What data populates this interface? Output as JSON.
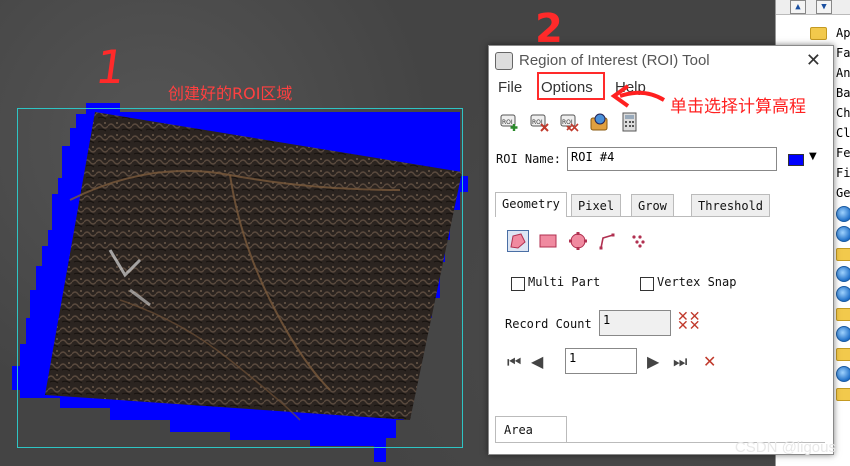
{
  "annotations": {
    "step1": "1",
    "step2": "2",
    "roi_created_text": "创建好的ROI区域",
    "step2_text": "单击选择计算高程"
  },
  "dialog": {
    "title": "Region of Interest (ROI) Tool",
    "close": "✕",
    "menu": [
      "File",
      "Options",
      "Help"
    ],
    "toolbar_icons": [
      "new-roi-icon",
      "delete-roi-icon",
      "delete-all-roi-icon",
      "open-roi-icon",
      "calculator-icon"
    ],
    "roi_name_label": "ROI Name:",
    "roi_name_value": "ROI #4",
    "roi_color": "#0000ff",
    "tabs": [
      "Geometry",
      "Pixel",
      "Grow",
      "Threshold"
    ],
    "geometry_tools": [
      "polygon-tool-icon",
      "rectangle-tool-icon",
      "ellipse-tool-icon",
      "polyline-tool-icon",
      "point-tool-icon"
    ],
    "multi_part_label": "Multi Part",
    "vertex_snap_label": "Vertex Snap",
    "record_count_label": "Record Count",
    "record_count_value": "1",
    "nav_value": "1",
    "bottom_tab": "Area"
  },
  "tree": {
    "items": [
      "Ap",
      "Fa",
      "An",
      "Ba",
      "Ch",
      "Cl",
      "Fe",
      "Fi",
      "Ge"
    ]
  },
  "watermark": "CSDN @ligous",
  "colors": {
    "annotation": "#ff2a2a",
    "roi_fill": "#0000ff",
    "roi_box": "#2ec4c4"
  }
}
